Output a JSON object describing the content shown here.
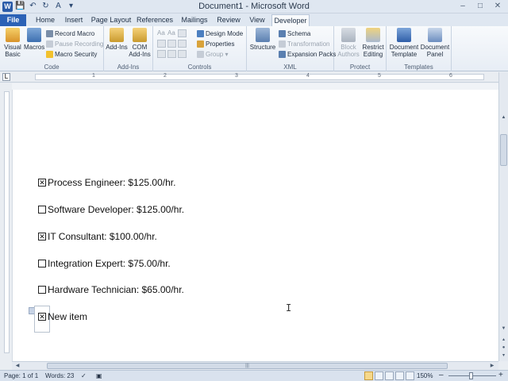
{
  "window": {
    "title": "Document1 - Microsoft Word",
    "logo_letter": "W",
    "qat": [
      "save-icon",
      "undo-icon",
      "redo-icon",
      "font-color-icon",
      "customize-icon"
    ],
    "buttons": [
      "–",
      "□",
      "✕"
    ]
  },
  "tabs": [
    {
      "label": "File"
    },
    {
      "label": "Home"
    },
    {
      "label": "Insert"
    },
    {
      "label": "Page Layout"
    },
    {
      "label": "References"
    },
    {
      "label": "Mailings"
    },
    {
      "label": "Review"
    },
    {
      "label": "View"
    },
    {
      "label": "Developer",
      "active": true
    }
  ],
  "ribbon": {
    "code": {
      "label": "Code",
      "visual_basic": "Visual Basic",
      "macros": "Macros",
      "record_macro": "Record Macro",
      "pause_recording": "Pause Recording",
      "macro_security": "Macro Security"
    },
    "addins": {
      "label": "Add-Ins",
      "addins": "Add-Ins",
      "com_addins_1": "COM",
      "com_addins_2": "Add-Ins"
    },
    "controls": {
      "label": "Controls",
      "design_mode": "Design Mode",
      "properties": "Properties",
      "group": "Group"
    },
    "xml": {
      "label": "XML",
      "structure": "Structure",
      "schema": "Schema",
      "transformation": "Transformation",
      "expansion_packs": "Expansion Packs"
    },
    "protect": {
      "label": "Protect",
      "block_authors_1": "Block",
      "block_authors_2": "Authors",
      "restrict_editing_1": "Restrict",
      "restrict_editing_2": "Editing"
    },
    "templates": {
      "label": "Templates",
      "document_template_1": "Document",
      "document_template_2": "Template",
      "document_panel_1": "Document",
      "document_panel_2": "Panel"
    }
  },
  "ruler": {
    "tab_selector": "L",
    "numbers": [
      "1",
      "2",
      "3",
      "4",
      "5",
      "6"
    ]
  },
  "document": {
    "items": [
      {
        "checked": true,
        "text": "Process Engineer: $125.00/hr."
      },
      {
        "checked": false,
        "text": "Software Developer: $125.00/hr."
      },
      {
        "checked": true,
        "text": "IT Consultant: $100.00/hr."
      },
      {
        "checked": false,
        "text": "Integration Expert: $75.00/hr."
      },
      {
        "checked": false,
        "text": "Hardware Technician: $65.00/hr."
      },
      {
        "checked": true,
        "text": "New item"
      }
    ],
    "check_glyph": "✕",
    "cursor_glyph": "I"
  },
  "statusbar": {
    "page": "Page: 1 of 1",
    "words": "Words: 23",
    "zoom": "150%",
    "zoom_minus": "–",
    "zoom_plus": "+"
  },
  "colors": {
    "file_tab": "#2c62b6",
    "ribbon_bg": "#f8fafc",
    "page_bg": "#ffffff"
  }
}
